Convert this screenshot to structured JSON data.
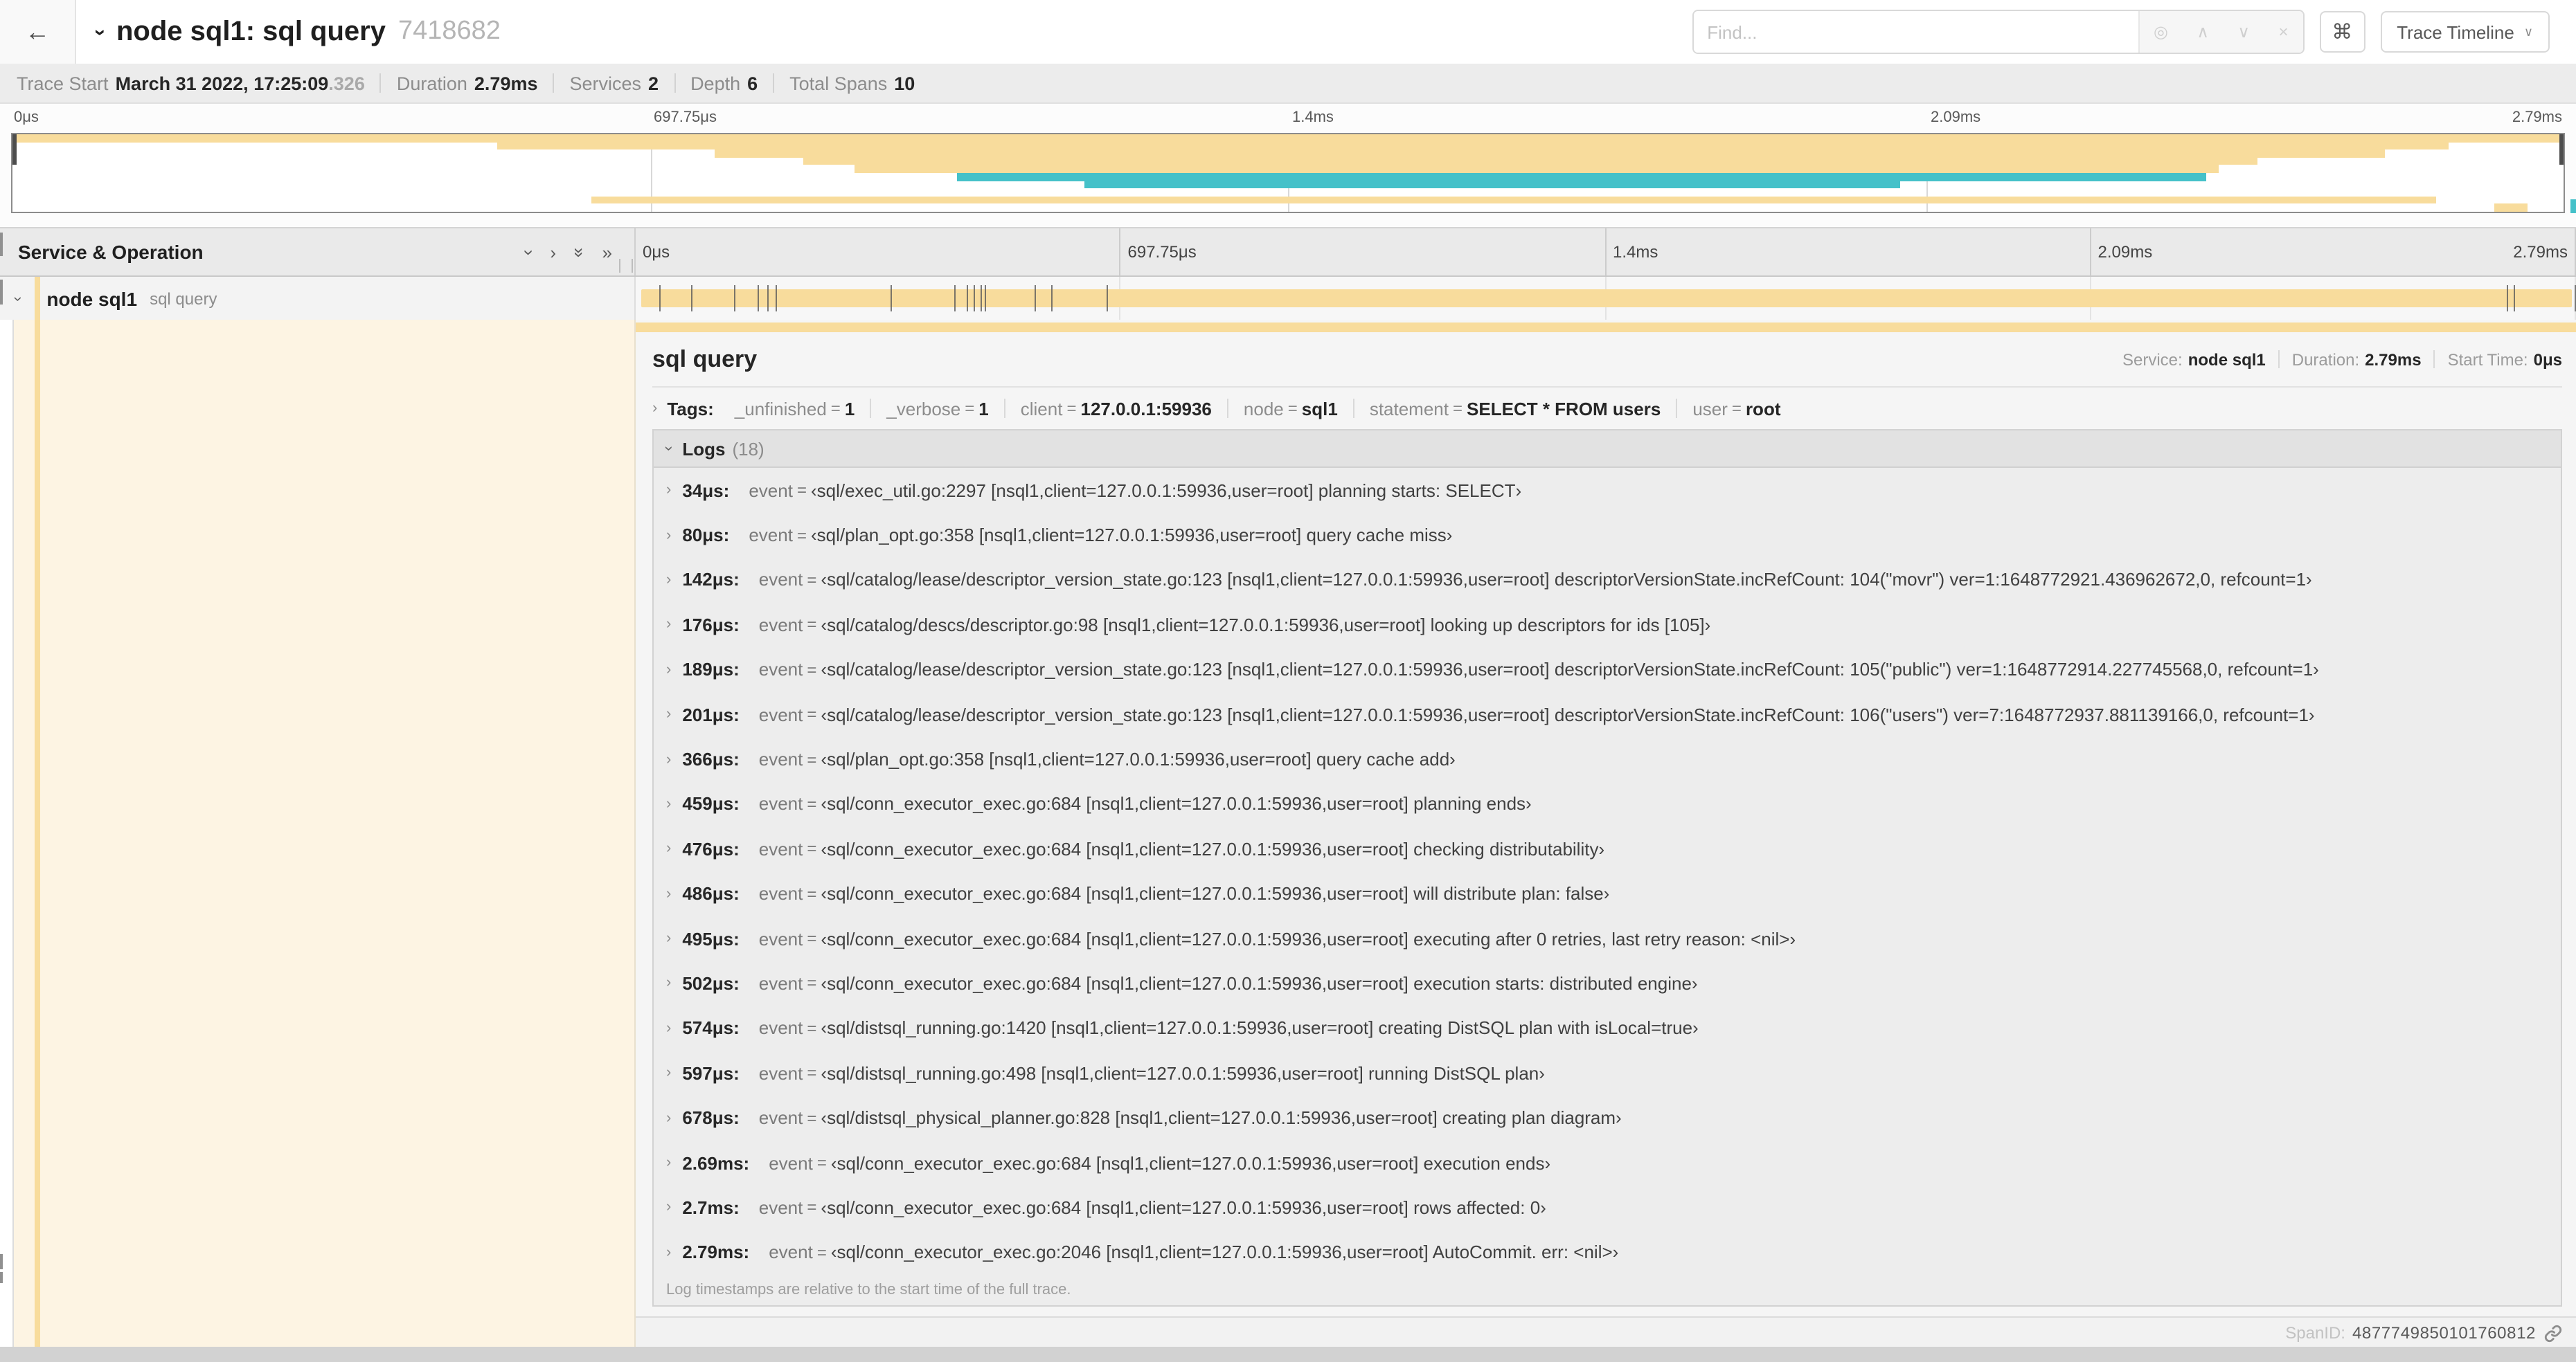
{
  "colors": {
    "tan": "#f8dc9c",
    "teal": "#45c1c9"
  },
  "icons": {
    "back": "←",
    "locate": "◎",
    "prev": "∧",
    "next": "∨",
    "clear": "×",
    "shortcut": "⌘",
    "caret": "∨",
    "chevron": "›",
    "chevron_double": "»",
    "grip": "∥"
  },
  "topbar": {
    "title": "node sql1: sql query",
    "trace_id": "7418682",
    "find_placeholder": "Find...",
    "view_button": "Trace Timeline"
  },
  "stats": [
    {
      "label": "Trace Start",
      "value": "March 31 2022, 17:25:09",
      "suffix": ".326"
    },
    {
      "label": "Duration",
      "value": "2.79ms"
    },
    {
      "label": "Services",
      "value": "2"
    },
    {
      "label": "Depth",
      "value": "6"
    },
    {
      "label": "Total Spans",
      "value": "10"
    }
  ],
  "timeline": {
    "column_header": "Service & Operation",
    "ticks": [
      "0μs",
      "697.75μs",
      "1.4ms",
      "2.09ms",
      "2.79ms"
    ],
    "total_us": 2790
  },
  "minimap": {
    "bars": [
      {
        "row": 1,
        "start": 0,
        "end": 100,
        "color": "tan"
      },
      {
        "row": 2,
        "start": 19,
        "end": 95.5,
        "color": "tan"
      },
      {
        "row": 3,
        "start": 27.5,
        "end": 93,
        "color": "tan"
      },
      {
        "row": 4,
        "start": 31,
        "end": 88,
        "color": "tan"
      },
      {
        "row": 5,
        "start": 33,
        "end": 86.5,
        "color": "tan"
      },
      {
        "row": 6,
        "start": 37,
        "end": 86,
        "color": "teal"
      },
      {
        "row": 7,
        "start": 42,
        "end": 74,
        "color": "teal"
      },
      {
        "row": 9,
        "start": 22.7,
        "end": 95,
        "color": "tan"
      },
      {
        "row": 10,
        "start": 97.3,
        "end": 98.6,
        "color": "tan"
      }
    ]
  },
  "span": {
    "service": "node sql1",
    "operation": "sql query",
    "bar": {
      "start": 0.3,
      "end": 99.8,
      "color": "tan"
    }
  },
  "detail": {
    "title": "sql query",
    "summary": [
      {
        "label": "Service:",
        "value": "node sql1"
      },
      {
        "label": "Duration:",
        "value": "2.79ms"
      },
      {
        "label": "Start Time:",
        "value": "0μs"
      }
    ],
    "tags_label": "Tags:",
    "tags": [
      {
        "key": "_unfinished",
        "value": "1"
      },
      {
        "key": "_verbose",
        "value": "1"
      },
      {
        "key": "client",
        "value": "127.0.0.1:59936"
      },
      {
        "key": "node",
        "value": "sql1"
      },
      {
        "key": "statement",
        "value": "SELECT * FROM users"
      },
      {
        "key": "user",
        "value": "root"
      }
    ],
    "logs_label": "Logs",
    "logs_count": "(18)",
    "log_field": "event",
    "quote_open": "‹",
    "quote_close": "›",
    "logs": [
      {
        "t": "34μs:",
        "us": 34,
        "value": "sql/exec_util.go:2297 [nsql1,client=127.0.0.1:59936,user=root] planning starts: SELECT"
      },
      {
        "t": "80μs:",
        "us": 80,
        "value": "sql/plan_opt.go:358 [nsql1,client=127.0.0.1:59936,user=root] query cache miss"
      },
      {
        "t": "142μs:",
        "us": 142,
        "value": "sql/catalog/lease/descriptor_version_state.go:123 [nsql1,client=127.0.0.1:59936,user=root] descriptorVersionState.incRefCount: 104(\"movr\") ver=1:1648772921.436962672,0, refcount=1"
      },
      {
        "t": "176μs:",
        "us": 176,
        "value": "sql/catalog/descs/descriptor.go:98 [nsql1,client=127.0.0.1:59936,user=root] looking up descriptors for ids [105]"
      },
      {
        "t": "189μs:",
        "us": 189,
        "value": "sql/catalog/lease/descriptor_version_state.go:123 [nsql1,client=127.0.0.1:59936,user=root] descriptorVersionState.incRefCount: 105(\"public\") ver=1:1648772914.227745568,0, refcount=1"
      },
      {
        "t": "201μs:",
        "us": 201,
        "value": "sql/catalog/lease/descriptor_version_state.go:123 [nsql1,client=127.0.0.1:59936,user=root] descriptorVersionState.incRefCount: 106(\"users\") ver=7:1648772937.881139166,0, refcount=1"
      },
      {
        "t": "366μs:",
        "us": 366,
        "value": "sql/plan_opt.go:358 [nsql1,client=127.0.0.1:59936,user=root] query cache add"
      },
      {
        "t": "459μs:",
        "us": 459,
        "value": "sql/conn_executor_exec.go:684 [nsql1,client=127.0.0.1:59936,user=root] planning ends"
      },
      {
        "t": "476μs:",
        "us": 476,
        "value": "sql/conn_executor_exec.go:684 [nsql1,client=127.0.0.1:59936,user=root] checking distributability"
      },
      {
        "t": "486μs:",
        "us": 486,
        "value": "sql/conn_executor_exec.go:684 [nsql1,client=127.0.0.1:59936,user=root] will distribute plan: false"
      },
      {
        "t": "495μs:",
        "us": 495,
        "value": "sql/conn_executor_exec.go:684 [nsql1,client=127.0.0.1:59936,user=root] executing after 0 retries, last retry reason: <nil>"
      },
      {
        "t": "502μs:",
        "us": 502,
        "value": "sql/conn_executor_exec.go:684 [nsql1,client=127.0.0.1:59936,user=root] execution starts: distributed engine"
      },
      {
        "t": "574μs:",
        "us": 574,
        "value": "sql/distsql_running.go:1420 [nsql1,client=127.0.0.1:59936,user=root] creating DistSQL plan with isLocal=true"
      },
      {
        "t": "597μs:",
        "us": 597,
        "value": "sql/distsql_running.go:498 [nsql1,client=127.0.0.1:59936,user=root] running DistSQL plan"
      },
      {
        "t": "678μs:",
        "us": 678,
        "value": "sql/distsql_physical_planner.go:828 [nsql1,client=127.0.0.1:59936,user=root] creating plan diagram"
      },
      {
        "t": "2.69ms:",
        "us": 2690,
        "value": "sql/conn_executor_exec.go:684 [nsql1,client=127.0.0.1:59936,user=root] execution ends"
      },
      {
        "t": "2.7ms:",
        "us": 2700,
        "value": "sql/conn_executor_exec.go:684 [nsql1,client=127.0.0.1:59936,user=root] rows affected: 0"
      },
      {
        "t": "2.79ms:",
        "us": 2790,
        "value": "sql/conn_executor_exec.go:2046 [nsql1,client=127.0.0.1:59936,user=root] AutoCommit. err: <nil>"
      }
    ],
    "footnote": "Log timestamps are relative to the start time of the full trace.",
    "span_id_label": "SpanID:",
    "span_id": "4877749850101760812"
  }
}
